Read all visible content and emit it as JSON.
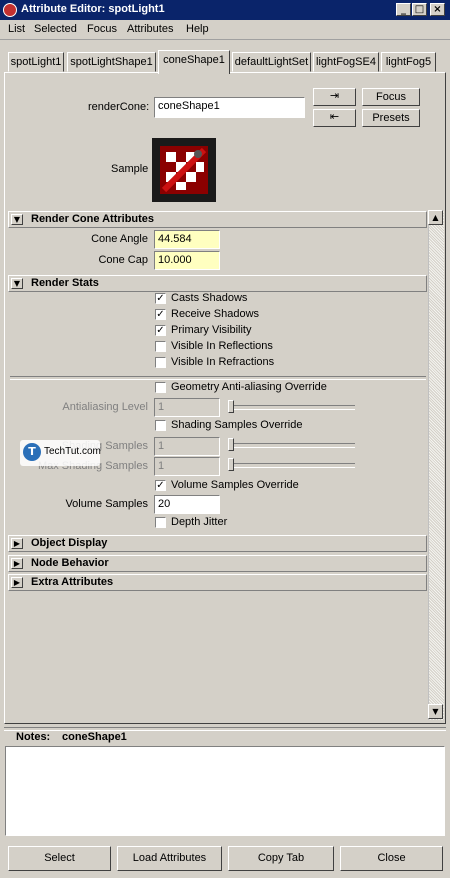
{
  "window": {
    "title": "Attribute Editor: spotLight1"
  },
  "menu": [
    "List",
    "Selected",
    "Focus",
    "Attributes",
    "Help"
  ],
  "tabs": [
    "spotLight1",
    "spotLightShape1",
    "coneShape1",
    "defaultLightSet",
    "lightFogSE4",
    "lightFog5"
  ],
  "active_tab": "coneShape1",
  "header": {
    "render_cone_label": "renderCone:",
    "render_cone_value": "coneShape1",
    "focus_button": "Focus",
    "presets_button": "Presets",
    "sample_label": "Sample"
  },
  "render_cone_section": {
    "title": "Render Cone Attributes",
    "cone_angle_label": "Cone Angle",
    "cone_angle_value": "44.584",
    "cone_cap_label": "Cone Cap",
    "cone_cap_value": "10.000"
  },
  "render_stats": {
    "title": "Render Stats",
    "checkboxes": [
      {
        "label": "Casts Shadows",
        "checked": true
      },
      {
        "label": "Receive Shadows",
        "checked": true
      },
      {
        "label": "Primary Visibility",
        "checked": true
      },
      {
        "label": "Visible In Reflections",
        "checked": false
      },
      {
        "label": "Visible In Refractions",
        "checked": false
      }
    ],
    "geometry_aa_override": {
      "label": "Geometry Anti-aliasing Override",
      "checked": false
    },
    "antialiasing_level_label": "Antialiasing Level",
    "antialiasing_level_value": "1",
    "shading_samples_override": {
      "label": "Shading Samples Override",
      "checked": false
    },
    "shading_samples_label": "Shading Samples",
    "shading_samples_value": "1",
    "max_shading_samples_label": "Max Shading Samples",
    "max_shading_samples_value": "1",
    "volume_samples_override": {
      "label": "Volume Samples Override",
      "checked": true
    },
    "volume_samples_label": "Volume Samples",
    "volume_samples_value": "20",
    "depth_jitter": {
      "label": "Depth Jitter",
      "checked": false
    }
  },
  "collapsed_sections": [
    "Object Display",
    "Node Behavior",
    "Extra Attributes"
  ],
  "watermark": "TechTut.com",
  "notes": {
    "label": "Notes:",
    "node": "coneShape1"
  },
  "bottom_buttons": [
    "Select",
    "Load Attributes",
    "Copy Tab",
    "Close"
  ],
  "colors": {
    "titlebar": "#0a246a",
    "panel": "#d4d0c8",
    "keyed_field": "#ffffc0"
  }
}
